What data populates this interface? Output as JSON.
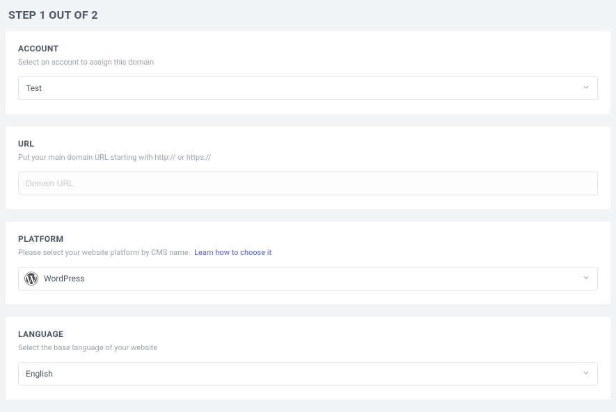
{
  "step_title": "STEP 1 OUT OF 2",
  "account": {
    "title": "ACCOUNT",
    "desc": "Select an account to assign this domain",
    "selected": "Test"
  },
  "url": {
    "title": "URL",
    "desc": "Put your main domain URL starting with http:// or https://",
    "placeholder": "Domain URL",
    "value": ""
  },
  "platform": {
    "title": "PLATFORM",
    "desc_prefix": "Please select your website platform by CMS name.",
    "link_text": "Learn how to choose it",
    "selected": "WordPress",
    "icon": "wordpress-icon"
  },
  "language": {
    "title": "LANGUAGE",
    "desc": "Select the base language of your website",
    "selected": "English"
  }
}
